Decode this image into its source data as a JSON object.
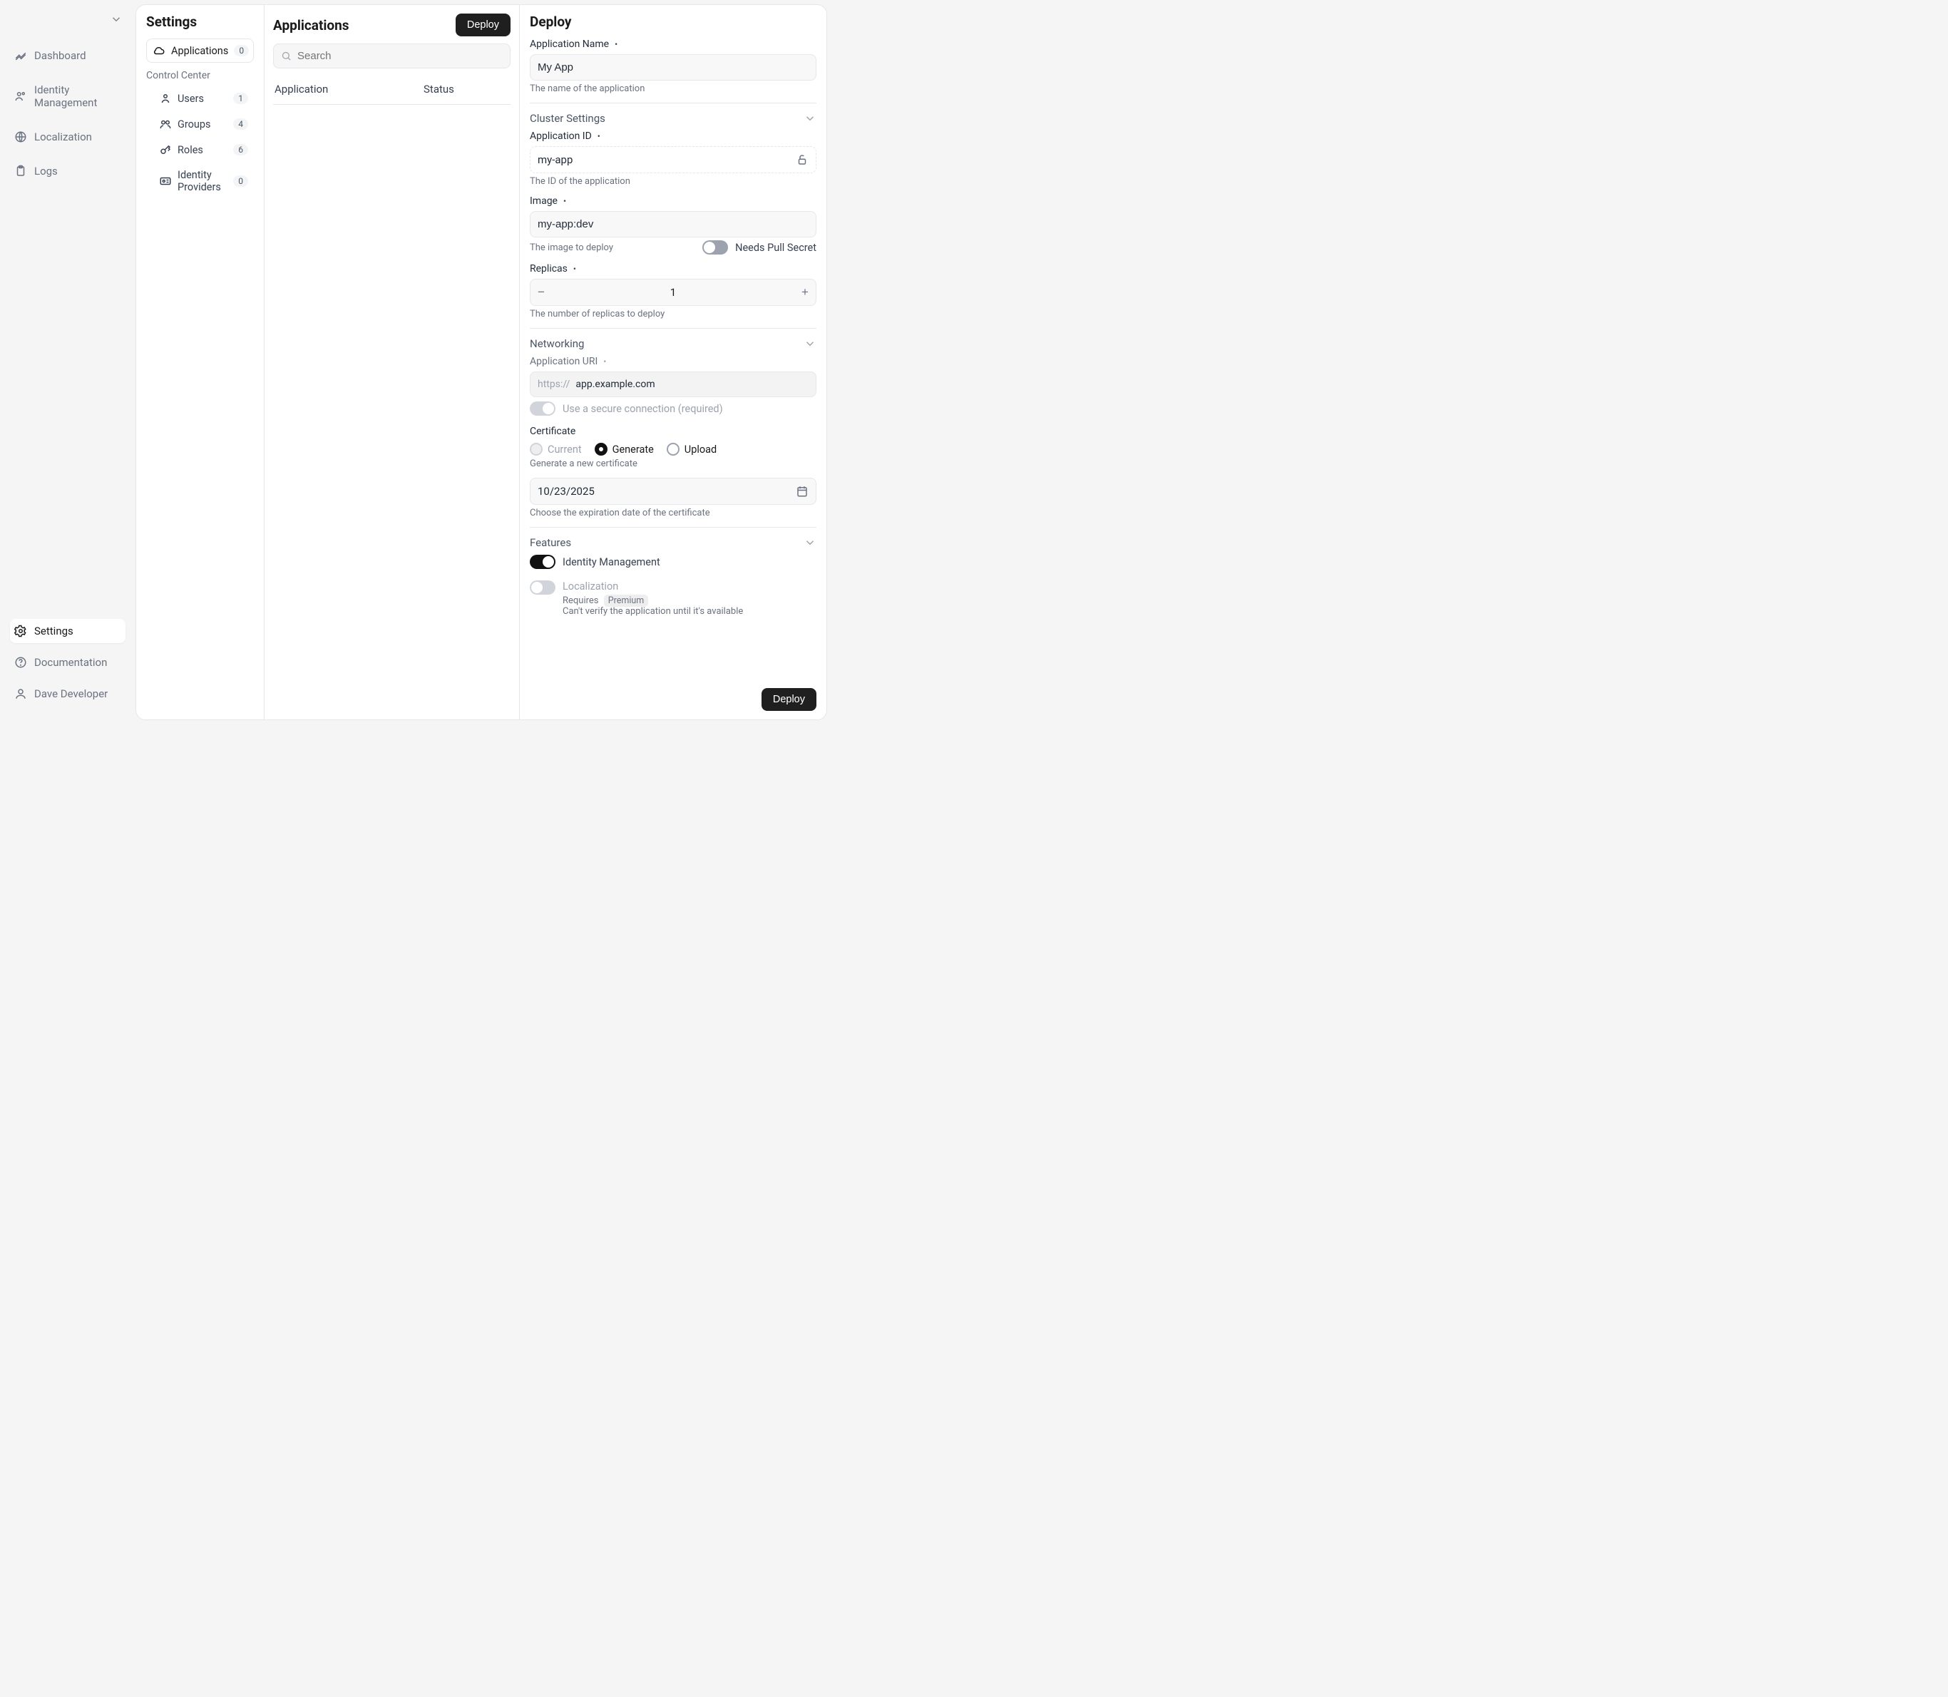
{
  "sidebar": {
    "top": [
      {
        "label": "Dashboard"
      },
      {
        "label": "Identity Management"
      },
      {
        "label": "Localization"
      },
      {
        "label": "Logs"
      }
    ],
    "bottom": {
      "settings": "Settings",
      "documentation": "Documentation",
      "user": "Dave Developer"
    }
  },
  "settings": {
    "title": "Settings",
    "applications": {
      "label": "Applications",
      "count": "0"
    },
    "controlCenterLabel": "Control Center",
    "items": [
      {
        "label": "Users",
        "count": "1"
      },
      {
        "label": "Groups",
        "count": "4"
      },
      {
        "label": "Roles",
        "count": "6"
      },
      {
        "label": "Identity Providers",
        "count": "0"
      }
    ]
  },
  "apps": {
    "title": "Applications",
    "deployBtn": "Deploy",
    "searchPlaceholder": "Search",
    "cols": {
      "application": "Application",
      "status": "Status"
    }
  },
  "deploy": {
    "title": "Deploy",
    "appName": {
      "label": "Application Name",
      "value": "My App",
      "helper": "The name of the application"
    },
    "cluster": {
      "heading": "Cluster Settings",
      "appId": {
        "label": "Application ID",
        "value": "my-app",
        "helper": "The ID of the application"
      },
      "image": {
        "label": "Image",
        "value": "my-app:dev",
        "helper": "The image to deploy",
        "pullSecretLabel": "Needs Pull Secret"
      },
      "replicas": {
        "label": "Replicas",
        "value": "1",
        "helper": "The number of replicas to deploy"
      }
    },
    "networking": {
      "heading": "Networking",
      "uri": {
        "label": "Application URI",
        "prefix": "https://",
        "value": "app.example.com"
      },
      "secureLabel": "Use a secure connection (required)",
      "cert": {
        "label": "Certificate",
        "options": {
          "current": "Current",
          "generate": "Generate",
          "upload": "Upload"
        },
        "helper": "Generate a new certificate",
        "date": "10/23/2025",
        "dateHelper": "Choose the expiration date of the certificate"
      }
    },
    "features": {
      "heading": "Features",
      "identity": "Identity Management",
      "localization": "Localization",
      "locReq": "Requires",
      "locChip": "Premium",
      "locNote": "Can't verify the application until it's available"
    },
    "submit": "Deploy"
  }
}
